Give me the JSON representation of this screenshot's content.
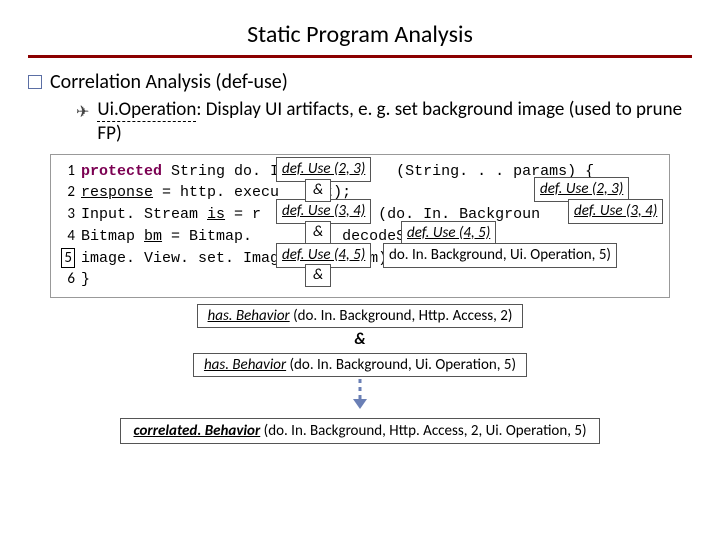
{
  "title": "Static Program Analysis",
  "bullet": "Correlation Analysis (def-use)",
  "sub_label": "Ui.Operation",
  "sub_text": ": Display UI artifacts, e. g. set background image (used to prune FP)",
  "code": {
    "l1_kw": "protected",
    "l1_a": " String do. I",
    "l1_b": "(String. . . params) {",
    "l2_a": "   ",
    "l2_var": "response",
    "l2_b": " = http. execu",
    "l2_c": "et);",
    "l3_a": "   Input. Stream ",
    "l3_var": "is",
    "l3_b": " = r",
    "l3_c": "(do. In. Backgroun",
    "l4_a": "   Bitmap ",
    "l4_var": "bm",
    "l4_b": " = Bitmap.",
    "l4_c": ". decodeStream(is);",
    "l5_a": "   image. View. set. Image. Bi",
    "l5_b": "om);",
    "l6": "}"
  },
  "overlays": {
    "a": "def. Use (2, 3)",
    "b": "def. Use (2, 3)",
    "c": "def. Use (3, 4)",
    "d": "def. Use (3, 4)",
    "e": "def. Use (4, 5)",
    "f": "def. Use (4, 5)",
    "g_tail": "do. In. Background, Ui. Operation, 5)"
  },
  "amp": "&",
  "behavior1_fn": "has. Behavior",
  "behavior1_args": " (do. In. Background, Http. Access, 2)",
  "behavior2_fn": "has. Behavior",
  "behavior2_args": " (do. In. Background, Ui. Operation, 5)",
  "final_fn": "correlated. Behavior",
  "final_args": " (do. In. Background, Http. Access, 2, Ui. Operation, 5)"
}
